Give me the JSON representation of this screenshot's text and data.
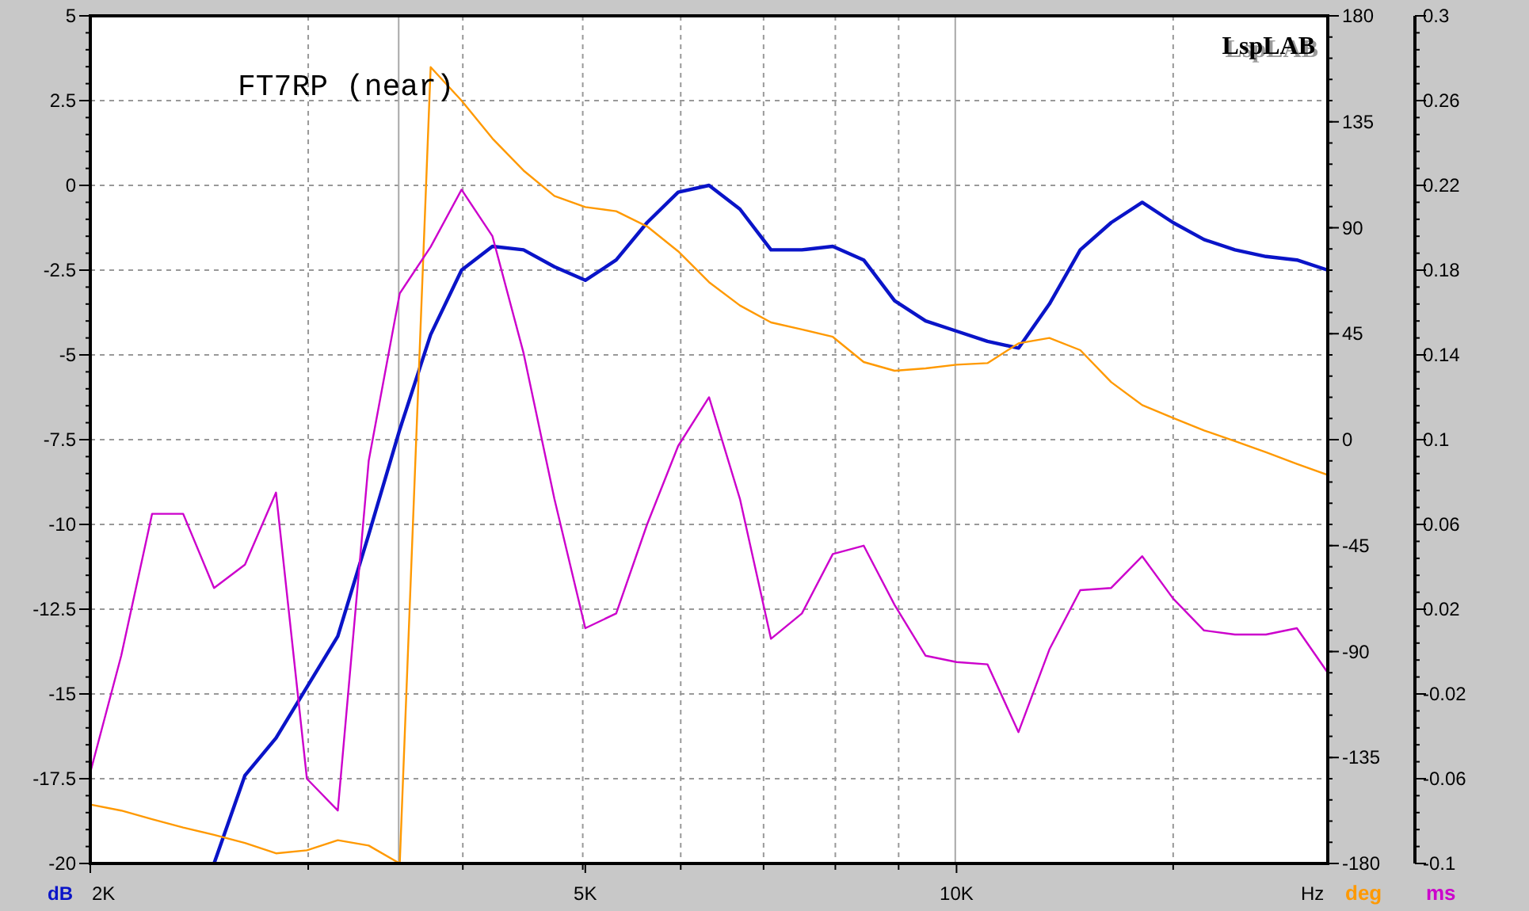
{
  "chart": {
    "title": "FT7RP (near)",
    "logo": "LspLAB",
    "chart_data": {
      "type": "line",
      "xlabel": "Hz",
      "grid": true,
      "categories": [
        "2K",
        null,
        null,
        null,
        null,
        null,
        null,
        null,
        null,
        null,
        null,
        null,
        null,
        null,
        null,
        null,
        "5K",
        null,
        null,
        null,
        null,
        null,
        null,
        null,
        null,
        null,
        null,
        null,
        "10K",
        null,
        null,
        null,
        null,
        null,
        null,
        null,
        null,
        null,
        null,
        null,
        null
      ],
      "ylim": [
        -20,
        5
      ],
      "yticks": [
        {
          "value": 5,
          "label": "5"
        },
        {
          "value": 2.5,
          "label": "2.5"
        },
        {
          "value": 0,
          "label": "0"
        },
        {
          "value": -2.5,
          "label": "-2.5"
        },
        {
          "value": -5,
          "label": "-5"
        },
        {
          "value": -7.5,
          "label": "-7.5"
        },
        {
          "value": -10,
          "label": "-10"
        },
        {
          "value": -12.5,
          "label": "-12.5"
        },
        {
          "value": -15,
          "label": "-15"
        },
        {
          "value": -17.5,
          "label": "-17.5"
        },
        {
          "value": -20,
          "label": "-20"
        }
      ],
      "y2lim": [
        -180,
        180
      ],
      "y2ticks": [
        {
          "value": 180,
          "label": "180"
        },
        {
          "value": 135,
          "label": "135"
        },
        {
          "value": 90,
          "label": "90"
        },
        {
          "value": 45,
          "label": "45"
        },
        {
          "value": 0,
          "label": "0"
        },
        {
          "value": -45,
          "label": "-45"
        },
        {
          "value": -90,
          "label": "-90"
        },
        {
          "value": -135,
          "label": "-135"
        },
        {
          "value": -180,
          "label": "-180"
        }
      ],
      "y3lim": [
        -0.1,
        0.3
      ],
      "y3ticks": [
        {
          "value": 0.3,
          "label": "0.3"
        },
        {
          "value": 0.26,
          "label": "0.26"
        },
        {
          "value": 0.22,
          "label": "0.22"
        },
        {
          "value": 0.18,
          "label": "0.18"
        },
        {
          "value": 0.14,
          "label": "0.14"
        },
        {
          "value": 0.1,
          "label": "0.1"
        },
        {
          "value": 0.06,
          "label": "0.06"
        },
        {
          "value": 0.02,
          "label": "0.02"
        },
        {
          "value": -0.02,
          "label": "-0.02"
        },
        {
          "value": -0.06,
          "label": "-0.06"
        },
        {
          "value": -0.1,
          "label": "-0.1"
        }
      ],
      "series": [
        {
          "name": "dB",
          "axis": "y",
          "color": "#0a14c8",
          "values": [
            null,
            null,
            null,
            null,
            -20,
            -17.4,
            -16.3,
            -14.8,
            -13.3,
            -10.3,
            -7.2,
            -4.4,
            -2.5,
            -1.8,
            -1.9,
            -2.4,
            -2.8,
            -2.2,
            -1.1,
            -0.2,
            0,
            -0.7,
            -1.9,
            -1.9,
            -1.8,
            -2.2,
            -3.4,
            -4,
            -4.3,
            -4.6,
            -4.8,
            -3.5,
            -1.9,
            -1.1,
            -0.5,
            -1.1,
            -1.6,
            -1.9,
            -2.1,
            -2.2,
            -2.5
          ]
        },
        {
          "name": "deg",
          "axis": "y2",
          "color": "#ff9900",
          "values": [
            -155,
            -157.5,
            -161.2,
            -164.7,
            -167.8,
            -171.3,
            -175.7,
            -174.4,
            -170.1,
            -172.4,
            -180,
            158.2,
            144,
            127.9,
            114.3,
            103.5,
            98.8,
            97,
            90.6,
            80,
            66.9,
            57,
            49.8,
            46.8,
            43.7,
            33,
            29.3,
            30.3,
            31.8,
            32.5,
            40.9,
            43.2,
            38,
            24.4,
            14.7,
            9.2,
            3.9,
            -0.6,
            -5.3,
            -10.3,
            -15
          ]
        },
        {
          "name": "ms",
          "axis": "y3",
          "color": "#cc00cc",
          "values": [
            -0.057,
            -0.002,
            0.065,
            0.065,
            0.03,
            0.041,
            0.075,
            -0.06,
            -0.075,
            0.09,
            0.169,
            0.191,
            0.218,
            0.196,
            0.141,
            0.072,
            0.011,
            0.018,
            0.06,
            0.097,
            0.12,
            0.072,
            0.006,
            0.018,
            0.046,
            0.05,
            0.022,
            -0.002,
            -0.005,
            -0.006,
            -0.038,
            0.001,
            0.029,
            0.03,
            0.045,
            0.025,
            0.01,
            0.008,
            0.008,
            0.011,
            -0.01
          ]
        }
      ]
    }
  }
}
